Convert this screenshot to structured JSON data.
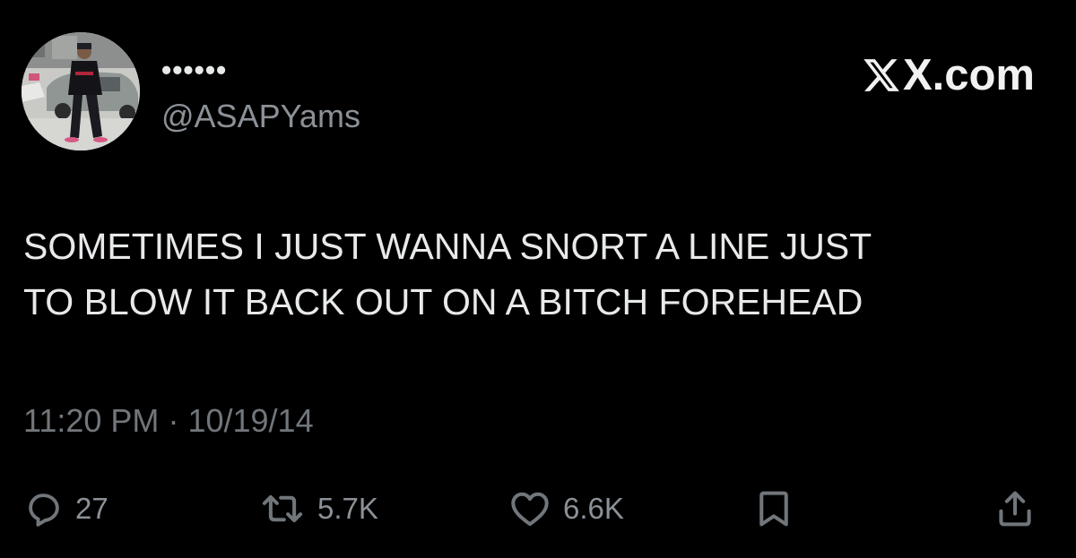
{
  "header": {
    "display_name": "••••••",
    "handle": "@ASAPYams",
    "brand": "X.com",
    "avatar_icon": "profile-photo",
    "brand_icon": "x-logo-icon"
  },
  "tweet": {
    "lines": [
      "SOMETIMES I JUST WANNA SNORT A LINE JUST",
      "TO BLOW IT BACK OUT ON A BITCH FOREHEAD"
    ],
    "time": "11:20 PM",
    "separator": "·",
    "date": "10/19/14"
  },
  "actions": {
    "replies": "27",
    "reposts": "5.7K",
    "likes": "6.6K",
    "icons": [
      "reply-icon",
      "repost-icon",
      "like-icon",
      "bookmark-icon",
      "share-icon"
    ]
  },
  "colors": {
    "background": "#000000",
    "text": "#e7e9ea",
    "muted": "#71767b"
  }
}
